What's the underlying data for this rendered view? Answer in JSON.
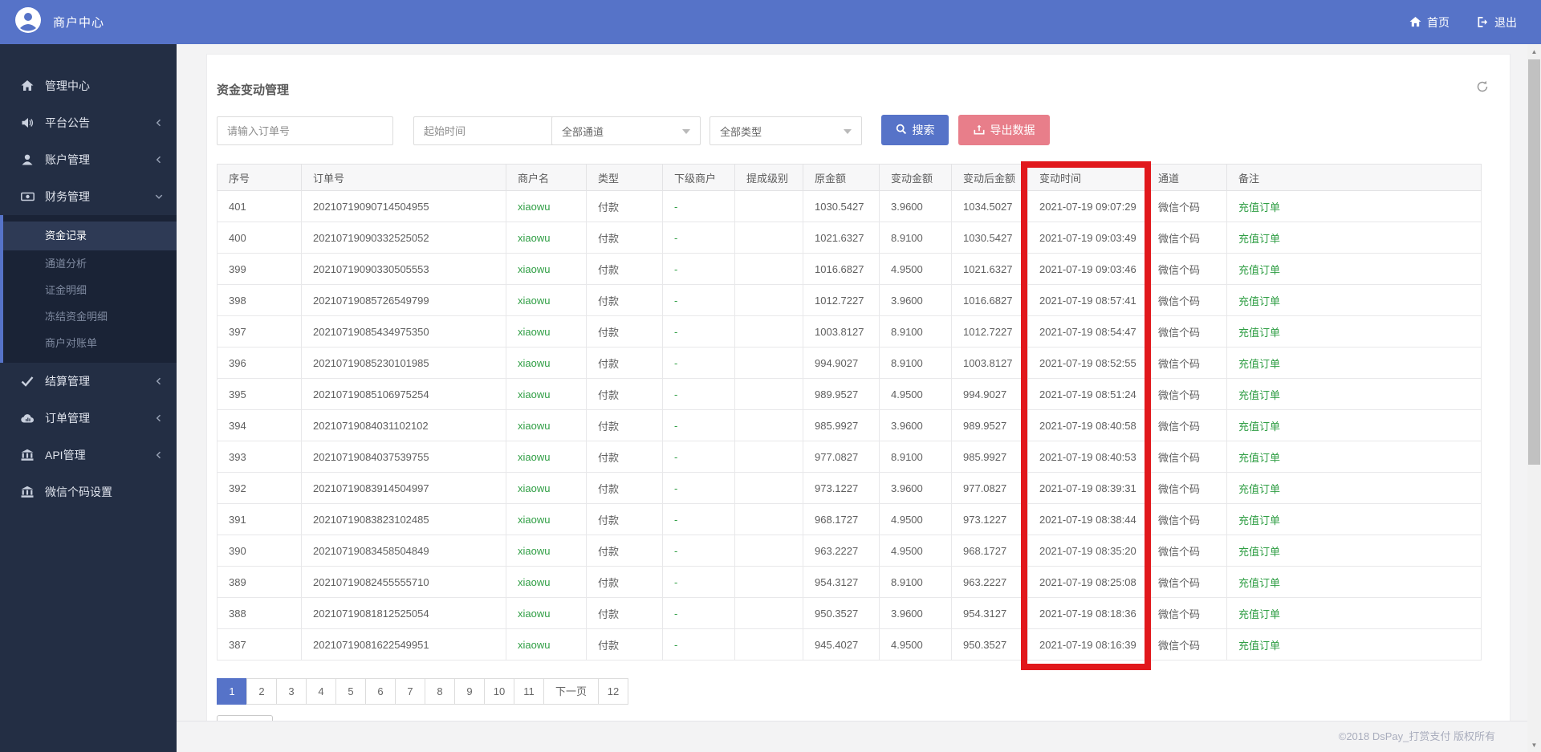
{
  "colors": {
    "blue": "#5673c8",
    "pink": "#e87e8a",
    "green": "#2f9e44",
    "annotation_red": "#e1181c"
  },
  "topbar": {
    "brand": "商户中心",
    "home": "首页",
    "logout": "退出"
  },
  "sidebar": {
    "items_top": [
      {
        "id": "admin-center",
        "label": "管理中心",
        "icon": "home-icon",
        "caret": "none"
      },
      {
        "id": "platform-notice",
        "label": "平台公告",
        "icon": "speaker-icon",
        "caret": "left"
      },
      {
        "id": "account-manage",
        "label": "账户管理",
        "icon": "user-icon",
        "caret": "left"
      },
      {
        "id": "finance-manage",
        "label": "财务管理",
        "icon": "money-icon",
        "caret": "down"
      }
    ],
    "submenu": [
      {
        "id": "fund-records",
        "label": "资金记录",
        "active": true
      },
      {
        "id": "channel-analysis",
        "label": "通道分析",
        "active": false
      },
      {
        "id": "deposit-detail",
        "label": "证金明细",
        "active": false
      },
      {
        "id": "frozen-fund-detail",
        "label": "冻结资金明细",
        "active": false
      },
      {
        "id": "merchant-statement",
        "label": "商户对账单",
        "active": false
      }
    ],
    "items_bottom": [
      {
        "id": "settlement-manage",
        "label": "结算管理",
        "icon": "check-icon",
        "caret": "left"
      },
      {
        "id": "order-manage",
        "label": "订单管理",
        "icon": "cloud-icon",
        "caret": "left"
      },
      {
        "id": "api-manage",
        "label": "API管理",
        "icon": "bank-icon",
        "caret": "left"
      },
      {
        "id": "wechat-code-settings",
        "label": "微信个码设置",
        "icon": "bank-icon",
        "caret": "none"
      }
    ]
  },
  "page": {
    "title": "资金变动管理"
  },
  "filters": {
    "order_placeholder": "请输入订单号",
    "time_placeholder": "起始时间",
    "channel_selected": "全部通道",
    "type_selected": "全部类型",
    "search_label": "搜索",
    "export_label": "导出数据"
  },
  "table": {
    "headers": [
      "序号",
      "订单号",
      "商户名",
      "类型",
      "下级商户",
      "提成级别",
      "原金额",
      "变动金额",
      "变动后金额",
      "变动时间",
      "通道",
      "备注"
    ],
    "rows": [
      [
        "401",
        "20210719090714504955",
        "xiaowu",
        "付款",
        "-",
        "",
        "1030.5427",
        "3.9600",
        "1034.5027",
        "2021-07-19 09:07:29",
        "微信个码",
        "充值订单"
      ],
      [
        "400",
        "20210719090332525052",
        "xiaowu",
        "付款",
        "-",
        "",
        "1021.6327",
        "8.9100",
        "1030.5427",
        "2021-07-19 09:03:49",
        "微信个码",
        "充值订单"
      ],
      [
        "399",
        "20210719090330505553",
        "xiaowu",
        "付款",
        "-",
        "",
        "1016.6827",
        "4.9500",
        "1021.6327",
        "2021-07-19 09:03:46",
        "微信个码",
        "充值订单"
      ],
      [
        "398",
        "20210719085726549799",
        "xiaowu",
        "付款",
        "-",
        "",
        "1012.7227",
        "3.9600",
        "1016.6827",
        "2021-07-19 08:57:41",
        "微信个码",
        "充值订单"
      ],
      [
        "397",
        "20210719085434975350",
        "xiaowu",
        "付款",
        "-",
        "",
        "1003.8127",
        "8.9100",
        "1012.7227",
        "2021-07-19 08:54:47",
        "微信个码",
        "充值订单"
      ],
      [
        "396",
        "20210719085230101985",
        "xiaowu",
        "付款",
        "-",
        "",
        "994.9027",
        "8.9100",
        "1003.8127",
        "2021-07-19 08:52:55",
        "微信个码",
        "充值订单"
      ],
      [
        "395",
        "20210719085106975254",
        "xiaowu",
        "付款",
        "-",
        "",
        "989.9527",
        "4.9500",
        "994.9027",
        "2021-07-19 08:51:24",
        "微信个码",
        "充值订单"
      ],
      [
        "394",
        "20210719084031102102",
        "xiaowu",
        "付款",
        "-",
        "",
        "985.9927",
        "3.9600",
        "989.9527",
        "2021-07-19 08:40:58",
        "微信个码",
        "充值订单"
      ],
      [
        "393",
        "20210719084037539755",
        "xiaowu",
        "付款",
        "-",
        "",
        "977.0827",
        "8.9100",
        "985.9927",
        "2021-07-19 08:40:53",
        "微信个码",
        "充值订单"
      ],
      [
        "392",
        "20210719083914504997",
        "xiaowu",
        "付款",
        "-",
        "",
        "973.1227",
        "3.9600",
        "977.0827",
        "2021-07-19 08:39:31",
        "微信个码",
        "充值订单"
      ],
      [
        "391",
        "20210719083823102485",
        "xiaowu",
        "付款",
        "-",
        "",
        "968.1727",
        "4.9500",
        "973.1227",
        "2021-07-19 08:38:44",
        "微信个码",
        "充值订单"
      ],
      [
        "390",
        "20210719083458504849",
        "xiaowu",
        "付款",
        "-",
        "",
        "963.2227",
        "4.9500",
        "968.1727",
        "2021-07-19 08:35:20",
        "微信个码",
        "充值订单"
      ],
      [
        "389",
        "20210719082455555710",
        "xiaowu",
        "付款",
        "-",
        "",
        "954.3127",
        "8.9100",
        "963.2227",
        "2021-07-19 08:25:08",
        "微信个码",
        "充值订单"
      ],
      [
        "388",
        "20210719081812525054",
        "xiaowu",
        "付款",
        "-",
        "",
        "950.3527",
        "3.9600",
        "954.3127",
        "2021-07-19 08:18:36",
        "微信个码",
        "充值订单"
      ],
      [
        "387",
        "20210719081622549951",
        "xiaowu",
        "付款",
        "-",
        "",
        "945.4027",
        "4.9500",
        "950.3527",
        "2021-07-19 08:16:39",
        "微信个码",
        "充值订单"
      ]
    ]
  },
  "pagination": {
    "pages": [
      "1",
      "2",
      "3",
      "4",
      "5",
      "6",
      "7",
      "8",
      "9",
      "10",
      "11",
      "下一页",
      "12"
    ],
    "active": "1"
  },
  "footer": {
    "copyright": "©2018 DsPay_打赏支付 版权所有"
  }
}
